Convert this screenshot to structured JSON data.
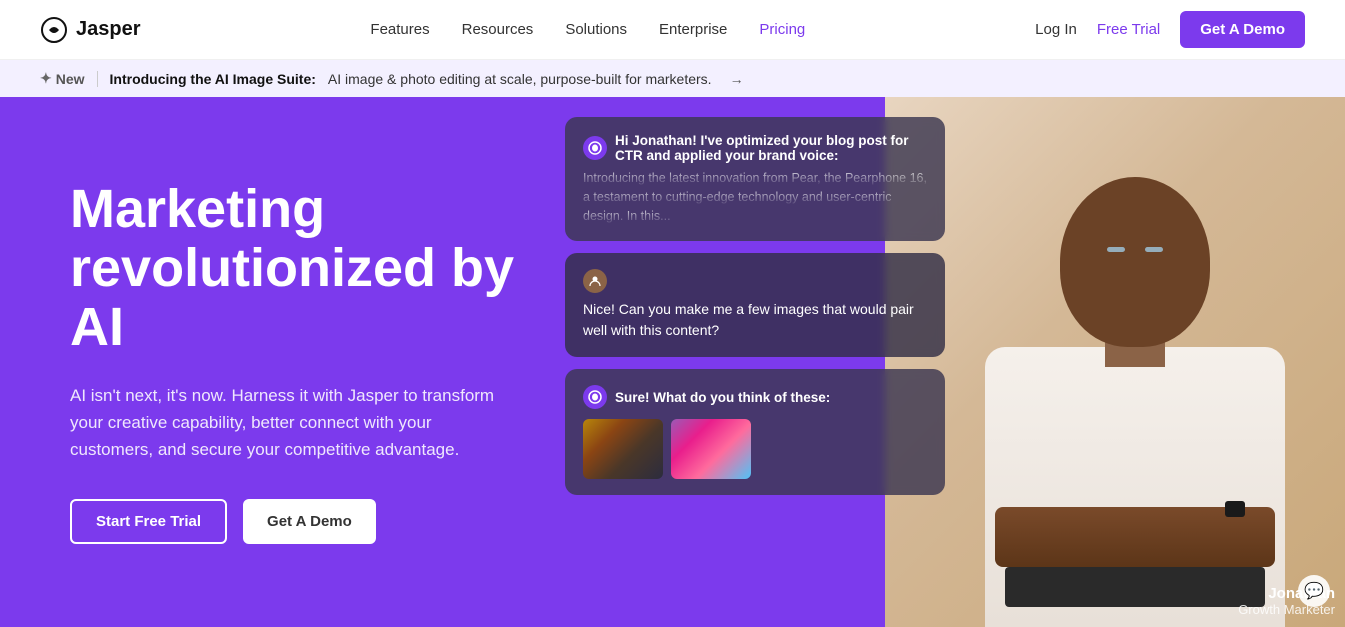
{
  "navbar": {
    "logo_text": "Jasper",
    "nav_links": [
      {
        "label": "Features",
        "active": false
      },
      {
        "label": "Resources",
        "active": false
      },
      {
        "label": "Solutions",
        "active": false
      },
      {
        "label": "Enterprise",
        "active": false
      },
      {
        "label": "Pricing",
        "active": true
      }
    ],
    "login_label": "Log In",
    "free_trial_label": "Free Trial",
    "get_demo_label": "Get A Demo"
  },
  "announcement": {
    "new_label": "New",
    "bold_text": "Introducing the AI Image Suite:",
    "body_text": "AI image & photo editing at scale, purpose-built for marketers.",
    "arrow": "→"
  },
  "hero": {
    "title": "Marketing revolutionized by AI",
    "subtitle": "AI isn't next, it's now. Harness it with Jasper to transform your creative capability, better connect with your customers, and secure your competitive advantage.",
    "start_trial_label": "Start Free Trial",
    "get_demo_label": "Get A Demo"
  },
  "chat": {
    "bubble1": {
      "title": "Hi Jonathan! I've optimized your blog post for CTR and applied your brand voice:",
      "body": "Introducing the latest innovation from Pear, the Pearphone 16, a testament to cutting-edge technology and user-centric design. In this..."
    },
    "bubble2": {
      "text": "Nice! Can you make me a few images that would pair well with this content?"
    },
    "bubble3": {
      "title": "Sure! What do you think of these:"
    }
  },
  "person": {
    "name": "Jonathan",
    "role": "Growth Marketer"
  },
  "icons": {
    "spark": "✦",
    "jasper_logo": "○",
    "chat_icon": "💬"
  }
}
